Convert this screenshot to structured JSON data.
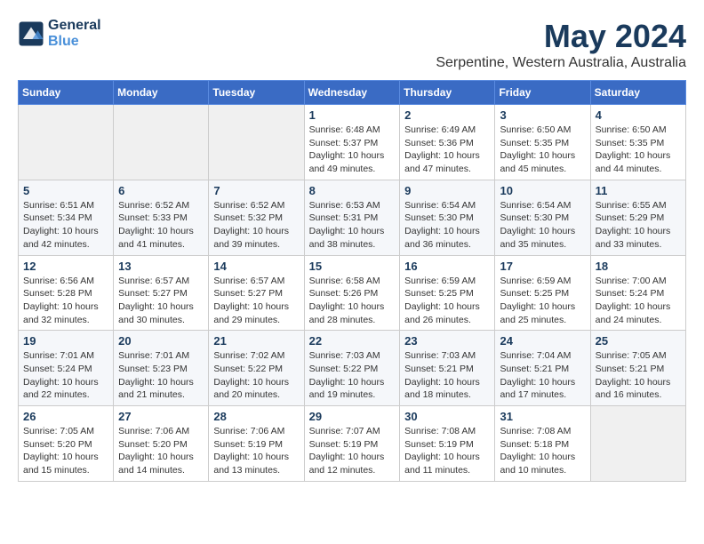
{
  "header": {
    "logo_line1": "General",
    "logo_line2": "Blue",
    "month": "May 2024",
    "location": "Serpentine, Western Australia, Australia"
  },
  "weekdays": [
    "Sunday",
    "Monday",
    "Tuesday",
    "Wednesday",
    "Thursday",
    "Friday",
    "Saturday"
  ],
  "weeks": [
    [
      {
        "day": "",
        "info": ""
      },
      {
        "day": "",
        "info": ""
      },
      {
        "day": "",
        "info": ""
      },
      {
        "day": "1",
        "info": "Sunrise: 6:48 AM\nSunset: 5:37 PM\nDaylight: 10 hours\nand 49 minutes."
      },
      {
        "day": "2",
        "info": "Sunrise: 6:49 AM\nSunset: 5:36 PM\nDaylight: 10 hours\nand 47 minutes."
      },
      {
        "day": "3",
        "info": "Sunrise: 6:50 AM\nSunset: 5:35 PM\nDaylight: 10 hours\nand 45 minutes."
      },
      {
        "day": "4",
        "info": "Sunrise: 6:50 AM\nSunset: 5:35 PM\nDaylight: 10 hours\nand 44 minutes."
      }
    ],
    [
      {
        "day": "5",
        "info": "Sunrise: 6:51 AM\nSunset: 5:34 PM\nDaylight: 10 hours\nand 42 minutes."
      },
      {
        "day": "6",
        "info": "Sunrise: 6:52 AM\nSunset: 5:33 PM\nDaylight: 10 hours\nand 41 minutes."
      },
      {
        "day": "7",
        "info": "Sunrise: 6:52 AM\nSunset: 5:32 PM\nDaylight: 10 hours\nand 39 minutes."
      },
      {
        "day": "8",
        "info": "Sunrise: 6:53 AM\nSunset: 5:31 PM\nDaylight: 10 hours\nand 38 minutes."
      },
      {
        "day": "9",
        "info": "Sunrise: 6:54 AM\nSunset: 5:30 PM\nDaylight: 10 hours\nand 36 minutes."
      },
      {
        "day": "10",
        "info": "Sunrise: 6:54 AM\nSunset: 5:30 PM\nDaylight: 10 hours\nand 35 minutes."
      },
      {
        "day": "11",
        "info": "Sunrise: 6:55 AM\nSunset: 5:29 PM\nDaylight: 10 hours\nand 33 minutes."
      }
    ],
    [
      {
        "day": "12",
        "info": "Sunrise: 6:56 AM\nSunset: 5:28 PM\nDaylight: 10 hours\nand 32 minutes."
      },
      {
        "day": "13",
        "info": "Sunrise: 6:57 AM\nSunset: 5:27 PM\nDaylight: 10 hours\nand 30 minutes."
      },
      {
        "day": "14",
        "info": "Sunrise: 6:57 AM\nSunset: 5:27 PM\nDaylight: 10 hours\nand 29 minutes."
      },
      {
        "day": "15",
        "info": "Sunrise: 6:58 AM\nSunset: 5:26 PM\nDaylight: 10 hours\nand 28 minutes."
      },
      {
        "day": "16",
        "info": "Sunrise: 6:59 AM\nSunset: 5:25 PM\nDaylight: 10 hours\nand 26 minutes."
      },
      {
        "day": "17",
        "info": "Sunrise: 6:59 AM\nSunset: 5:25 PM\nDaylight: 10 hours\nand 25 minutes."
      },
      {
        "day": "18",
        "info": "Sunrise: 7:00 AM\nSunset: 5:24 PM\nDaylight: 10 hours\nand 24 minutes."
      }
    ],
    [
      {
        "day": "19",
        "info": "Sunrise: 7:01 AM\nSunset: 5:24 PM\nDaylight: 10 hours\nand 22 minutes."
      },
      {
        "day": "20",
        "info": "Sunrise: 7:01 AM\nSunset: 5:23 PM\nDaylight: 10 hours\nand 21 minutes."
      },
      {
        "day": "21",
        "info": "Sunrise: 7:02 AM\nSunset: 5:22 PM\nDaylight: 10 hours\nand 20 minutes."
      },
      {
        "day": "22",
        "info": "Sunrise: 7:03 AM\nSunset: 5:22 PM\nDaylight: 10 hours\nand 19 minutes."
      },
      {
        "day": "23",
        "info": "Sunrise: 7:03 AM\nSunset: 5:21 PM\nDaylight: 10 hours\nand 18 minutes."
      },
      {
        "day": "24",
        "info": "Sunrise: 7:04 AM\nSunset: 5:21 PM\nDaylight: 10 hours\nand 17 minutes."
      },
      {
        "day": "25",
        "info": "Sunrise: 7:05 AM\nSunset: 5:21 PM\nDaylight: 10 hours\nand 16 minutes."
      }
    ],
    [
      {
        "day": "26",
        "info": "Sunrise: 7:05 AM\nSunset: 5:20 PM\nDaylight: 10 hours\nand 15 minutes."
      },
      {
        "day": "27",
        "info": "Sunrise: 7:06 AM\nSunset: 5:20 PM\nDaylight: 10 hours\nand 14 minutes."
      },
      {
        "day": "28",
        "info": "Sunrise: 7:06 AM\nSunset: 5:19 PM\nDaylight: 10 hours\nand 13 minutes."
      },
      {
        "day": "29",
        "info": "Sunrise: 7:07 AM\nSunset: 5:19 PM\nDaylight: 10 hours\nand 12 minutes."
      },
      {
        "day": "30",
        "info": "Sunrise: 7:08 AM\nSunset: 5:19 PM\nDaylight: 10 hours\nand 11 minutes."
      },
      {
        "day": "31",
        "info": "Sunrise: 7:08 AM\nSunset: 5:18 PM\nDaylight: 10 hours\nand 10 minutes."
      },
      {
        "day": "",
        "info": ""
      }
    ]
  ]
}
